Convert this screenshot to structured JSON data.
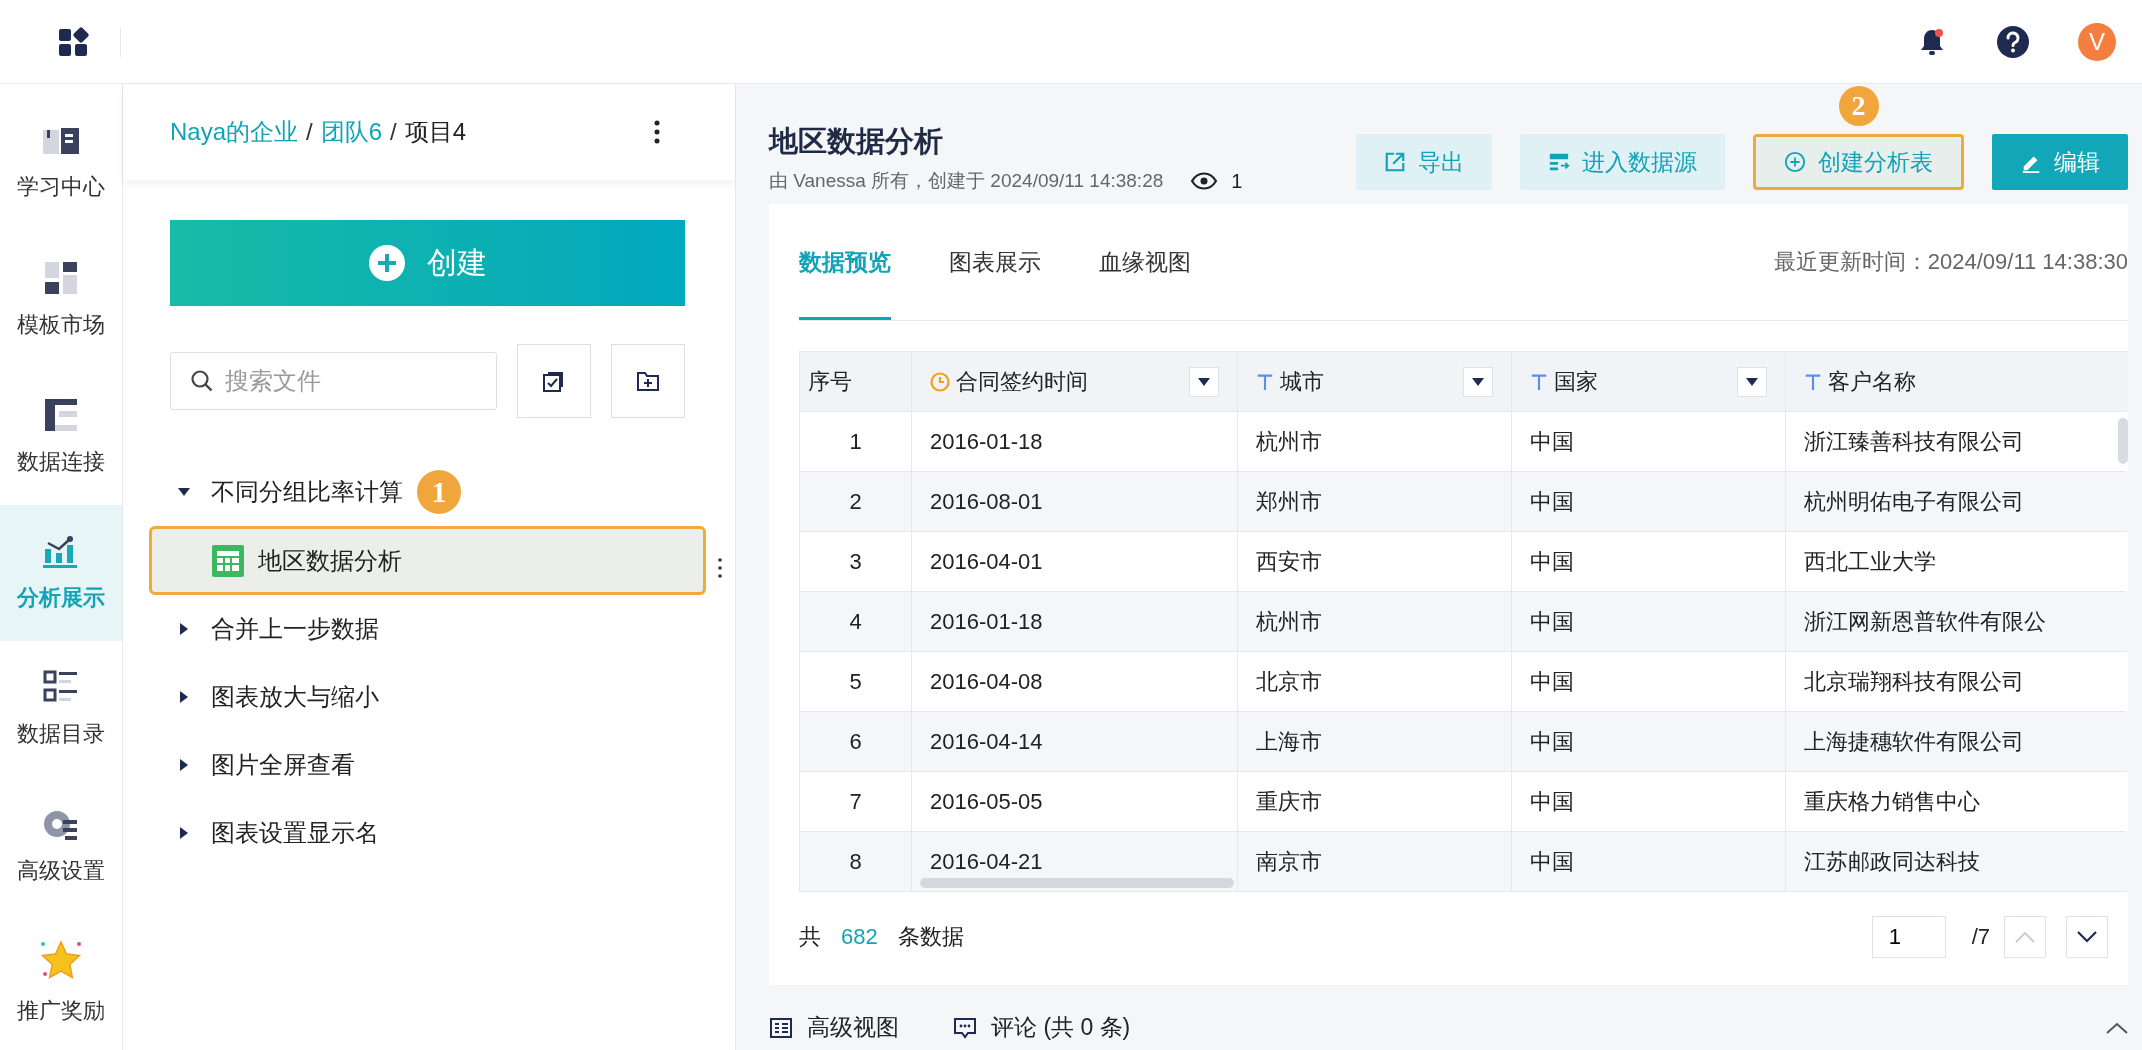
{
  "top_bar": {
    "avatar": "V",
    "notification": true
  },
  "nav": [
    {
      "label": "学习中心",
      "selected": false
    },
    {
      "label": "模板市场",
      "selected": false
    },
    {
      "label": "数据连接",
      "selected": false
    },
    {
      "label": "分析展示",
      "selected": true
    },
    {
      "label": "数据目录",
      "selected": false
    },
    {
      "label": "高级设置",
      "selected": false
    },
    {
      "label": "推广奖励",
      "selected": false
    }
  ],
  "breadcrumb": [
    {
      "label": "Naya的企业",
      "kind": "link"
    },
    {
      "label": "/",
      "kind": "separator"
    },
    {
      "label": "团队6",
      "kind": "link"
    },
    {
      "label": "/",
      "kind": "separator"
    },
    {
      "label": "项目4",
      "kind": "current"
    }
  ],
  "create_button": "创建",
  "search": {
    "placeholder": "搜索文件"
  },
  "tree": [
    {
      "label": "不同分组比率计算",
      "expanded": true,
      "badge": "1",
      "children": [
        {
          "label": "地区数据分析",
          "selected": true
        }
      ]
    },
    {
      "label": "合并上一步数据",
      "expanded": false
    },
    {
      "label": "图表放大与缩小",
      "expanded": false
    },
    {
      "label": "图片全屏查看",
      "expanded": false
    },
    {
      "label": "图表设置显示名",
      "expanded": false
    }
  ],
  "report": {
    "title": "地区数据分析",
    "meta": "由 Vanessa 所有，创建于 2024/09/11 14:38:28",
    "views": "1"
  },
  "actions": [
    {
      "label": "导出",
      "kind": "light"
    },
    {
      "label": "进入数据源",
      "kind": "light"
    },
    {
      "label": "创建分析表",
      "kind": "highlighted",
      "badge": "2"
    },
    {
      "label": "编辑",
      "kind": "primary"
    }
  ],
  "tabs": [
    {
      "label": "数据预览",
      "selected": true
    },
    {
      "label": "图表展示",
      "selected": false
    },
    {
      "label": "血缘视图",
      "selected": false
    }
  ],
  "updated": "最近更新时间：2024/09/11 14:38:30",
  "table": {
    "columns": [
      {
        "label": "序号",
        "kind": "index",
        "dropdown": false
      },
      {
        "label": "合同签约时间",
        "kind": "date",
        "dropdown": true
      },
      {
        "label": "城市",
        "kind": "text",
        "dropdown": true
      },
      {
        "label": "国家",
        "kind": "text",
        "dropdown": true
      },
      {
        "label": "客户名称",
        "kind": "text",
        "dropdown": false
      }
    ],
    "rows": [
      [
        "1",
        "2016-01-18",
        "杭州市",
        "中国",
        "浙江臻善科技有限公司"
      ],
      [
        "2",
        "2016-08-01",
        "郑州市",
        "中国",
        "杭州明佑电子有限公司"
      ],
      [
        "3",
        "2016-04-01",
        "西安市",
        "中国",
        "西北工业大学"
      ],
      [
        "4",
        "2016-01-18",
        "杭州市",
        "中国",
        "浙江网新恩普软件有限公"
      ],
      [
        "5",
        "2016-04-08",
        "北京市",
        "中国",
        "北京瑞翔科技有限公司"
      ],
      [
        "6",
        "2016-04-14",
        "上海市",
        "中国",
        "上海捷穗软件有限公司"
      ],
      [
        "7",
        "2016-05-05",
        "重庆市",
        "中国",
        "重庆格力销售中心"
      ],
      [
        "8",
        "2016-04-21",
        "南京市",
        "中国",
        "江苏邮政同达科技"
      ]
    ]
  },
  "footer": {
    "prefix": "共",
    "count": "682",
    "suffix": "条数据",
    "page": "1",
    "pages": "/7",
    "prev_disabled": true,
    "next_disabled": false
  },
  "bottom_bar": [
    {
      "label": "高级视图",
      "kind": "view"
    },
    {
      "label": "评论 (共 0 条)",
      "kind": "comment"
    }
  ]
}
